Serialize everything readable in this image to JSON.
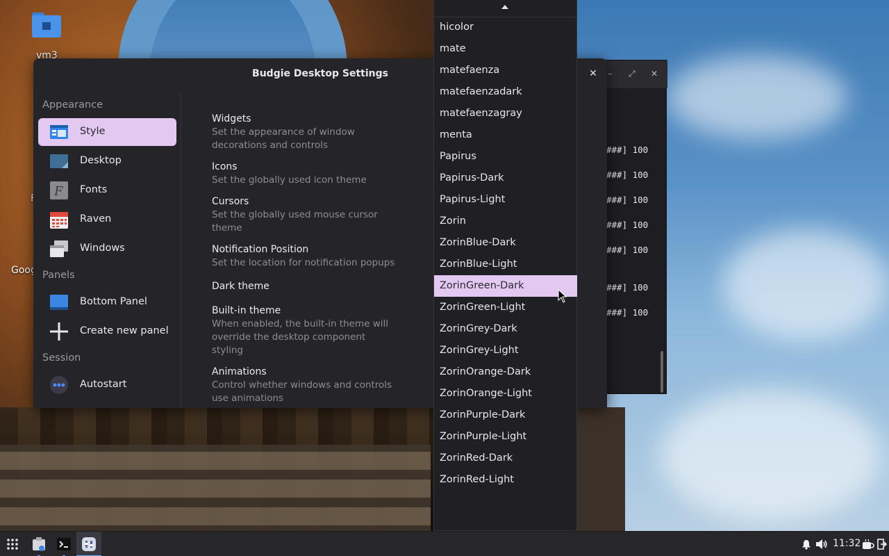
{
  "desktop": {
    "home_folder_label": "vm3",
    "partial_label_1": "F",
    "partial_label_2": "Goog"
  },
  "settings_window": {
    "title": "Budgie Desktop Settings",
    "close_glyph": "✕",
    "sidebar": {
      "sections": [
        "Appearance",
        "Panels",
        "Session"
      ],
      "items": [
        {
          "label": "Style",
          "icon": "style-icon",
          "active": true
        },
        {
          "label": "Desktop",
          "icon": "desktop-icon"
        },
        {
          "label": "Fonts",
          "icon": "fonts-icon"
        },
        {
          "label": "Raven",
          "icon": "raven-calendar-icon"
        },
        {
          "label": "Windows",
          "icon": "windows-icon"
        },
        {
          "label": "Bottom Panel",
          "icon": "panel-icon"
        },
        {
          "label": "Create new panel",
          "icon": "plus-icon"
        },
        {
          "label": "Autostart",
          "icon": "autostart-icon"
        }
      ]
    },
    "settings": [
      {
        "title": "Widgets",
        "desc": "Set the appearance of window decorations and controls"
      },
      {
        "title": "Icons",
        "desc": "Set the globally used icon theme"
      },
      {
        "title": "Cursors",
        "desc": "Set the globally used mouse cursor theme"
      },
      {
        "title": "Notification Position",
        "desc": "Set the location for notification popups"
      },
      {
        "title": "Dark theme",
        "desc": ""
      },
      {
        "title": "Built-in theme",
        "desc": "When enabled, the built-in theme will override the desktop component styling"
      },
      {
        "title": "Animations",
        "desc": "Control whether windows and controls use animations"
      }
    ]
  },
  "dropdown": {
    "items": [
      "hicolor",
      "mate",
      "matefaenza",
      "matefaenzadark",
      "matefaenzagray",
      "menta",
      "Papirus",
      "Papirus-Dark",
      "Papirus-Light",
      "Zorin",
      "ZorinBlue-Dark",
      "ZorinBlue-Light",
      "ZorinGreen-Dark",
      "ZorinGreen-Light",
      "ZorinGrey-Dark",
      "ZorinGrey-Light",
      "ZorinOrange-Dark",
      "ZorinOrange-Light",
      "ZorinPurple-Dark",
      "ZorinPurple-Light",
      "ZorinRed-Dark",
      "ZorinRed-Light"
    ],
    "hovered": "ZorinGreen-Dark"
  },
  "terminal": {
    "lines": [
      "###] 100",
      "###] 100",
      "###] 100",
      "###] 100",
      "###] 100",
      "###] 100",
      "###] 100"
    ],
    "buttons": [
      "–",
      "⤢",
      "✕"
    ]
  },
  "taskbar": {
    "clock": "11:32"
  },
  "colors": {
    "accent": "#e3c8f2",
    "panel_blue": "#4b92ea"
  }
}
